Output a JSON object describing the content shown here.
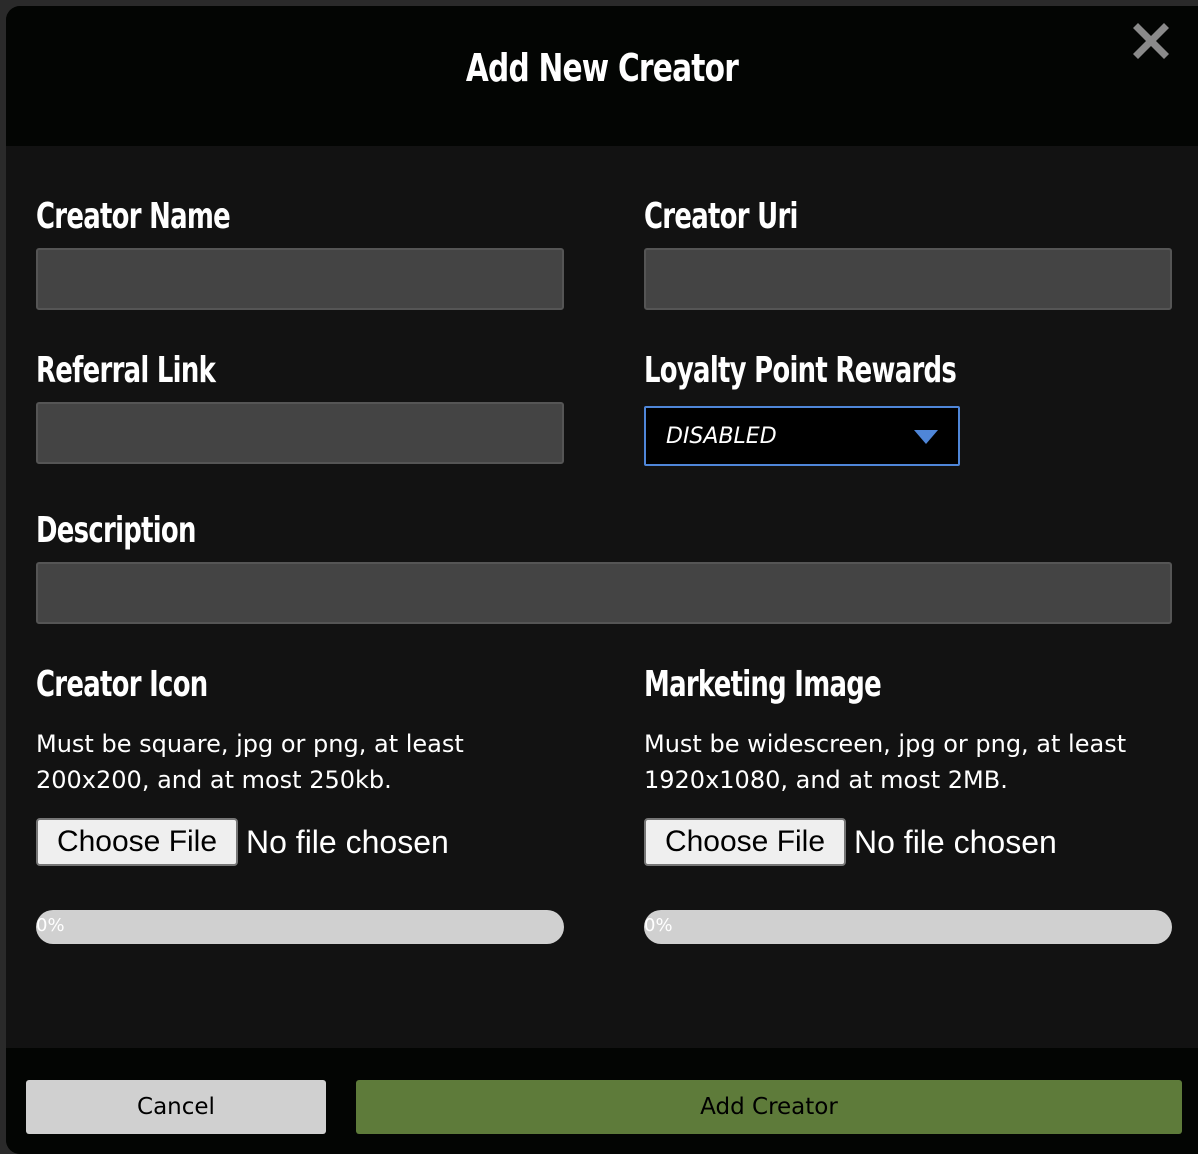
{
  "modal": {
    "title": "Add New Creator",
    "close_icon": "close-x-icon"
  },
  "fields": {
    "creator_name": {
      "label": "Creator Name",
      "value": ""
    },
    "creator_uri": {
      "label": "Creator Uri",
      "value": ""
    },
    "referral_link": {
      "label": "Referral Link",
      "value": ""
    },
    "loyalty_point_rewards": {
      "label": "Loyalty Point Rewards",
      "selected": "DISABLED"
    },
    "description": {
      "label": "Description",
      "value": ""
    }
  },
  "uploads": {
    "creator_icon": {
      "label": "Creator Icon",
      "help_line1": "Must be square, jpg or png, at least",
      "help_line2": "200x200, and at most 250kb.",
      "button_label": "Choose File",
      "status": "No file chosen",
      "progress_percent": 0,
      "progress_label": "0%"
    },
    "marketing_image": {
      "label": "Marketing Image",
      "help_line1": "Must be widescreen, jpg or png, at least",
      "help_line2": "1920x1080, and at most 2MB.",
      "button_label": "Choose File",
      "status": "No file chosen",
      "progress_percent": 0,
      "progress_label": "0%"
    }
  },
  "footer": {
    "cancel_label": "Cancel",
    "submit_label": "Add Creator"
  },
  "colors": {
    "accent_green": "#5e7b3a",
    "select_border": "#4f86d8",
    "input_bg": "#444444"
  }
}
